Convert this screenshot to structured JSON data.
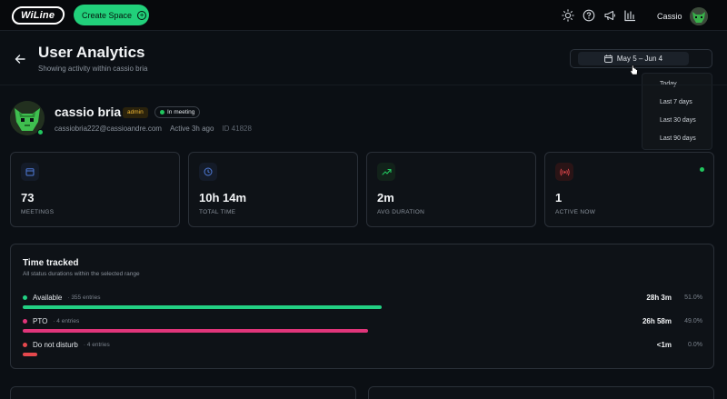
{
  "nav": {
    "logo_text": "WiLine",
    "create_space_label": "Create Space",
    "user_name": "Cassio"
  },
  "header": {
    "title": "User Analytics",
    "subtitle": "Showing activity within cassio bria",
    "date_range": "May 5 – Jun 4",
    "range_options": [
      "Today",
      "Last 7 days",
      "Last 30 days",
      "Last 90 days"
    ]
  },
  "profile": {
    "name": "cassio bria",
    "role": "admin",
    "status": "In meeting",
    "email": "cassiobria222@cassioandre.com",
    "last_active": "Active 3h ago",
    "id_label": "ID 41828"
  },
  "stats": [
    {
      "value": "73",
      "label": "MEETINGS",
      "icon": "calendar-icon",
      "color": "#4f7bd9"
    },
    {
      "value": "10h 14m",
      "label": "TOTAL TIME",
      "icon": "clock-icon",
      "color": "#4f7bd9"
    },
    {
      "value": "2m",
      "label": "AVG DURATION",
      "icon": "trending-up-icon",
      "color": "#22c55e"
    },
    {
      "value": "1",
      "label": "ACTIVE NOW",
      "icon": "broadcast-icon",
      "color": "#e5484d"
    }
  ],
  "time_tracked": {
    "title": "Time tracked",
    "subtitle": "All status durations within the selected range",
    "rows": [
      {
        "label": "Available",
        "count": "355 entries",
        "duration": "28h 3m",
        "pct": "51.0%",
        "fill": 0.51,
        "color": "#22d083"
      },
      {
        "label": "PTO",
        "count": "4 entries",
        "duration": "26h 58m",
        "pct": "49.0%",
        "fill": 0.49,
        "color": "#e0357a"
      },
      {
        "label": "Do not disturb",
        "count": "4 entries",
        "duration": "<1m",
        "pct": "0.0%",
        "fill": 0.02,
        "color": "#e5484d"
      }
    ]
  }
}
